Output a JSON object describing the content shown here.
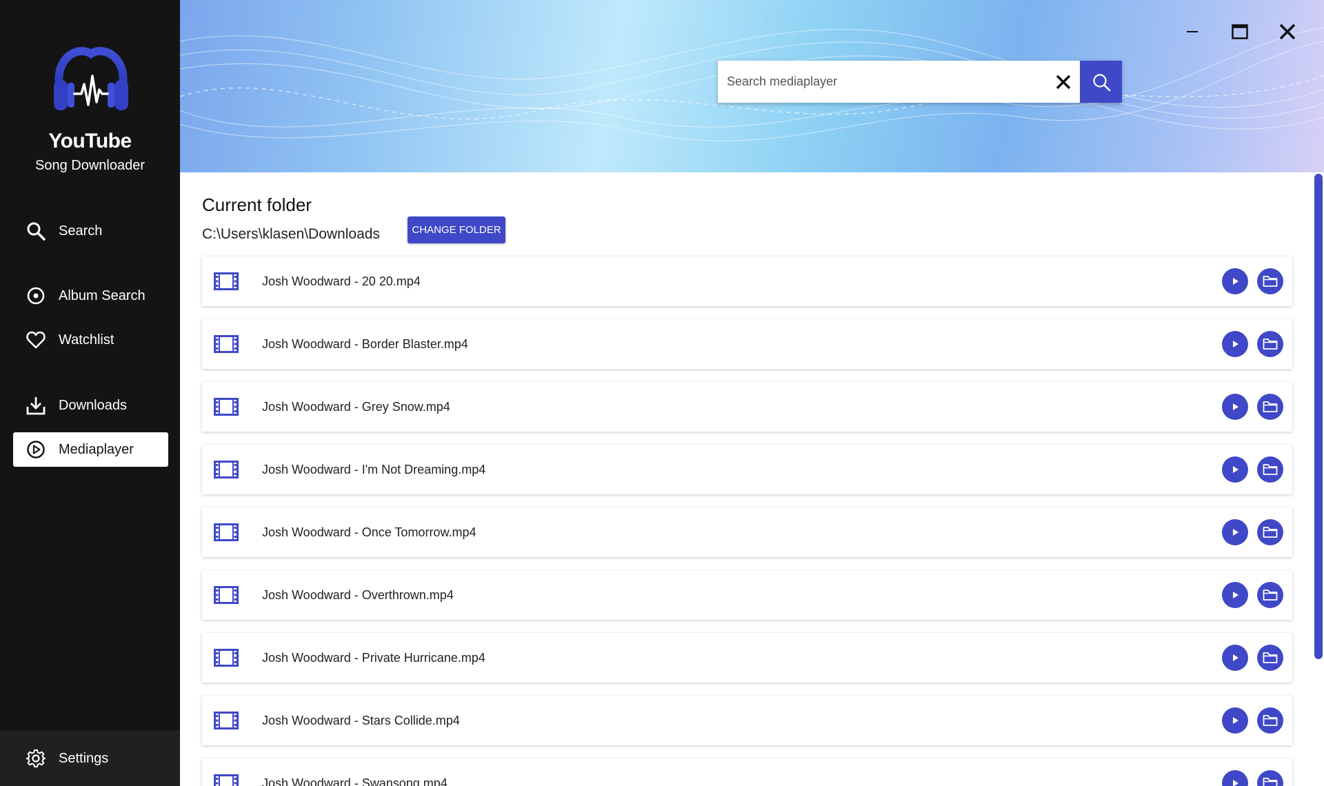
{
  "app": {
    "title": "YouTube",
    "subtitle": "Song Downloader"
  },
  "sidebar": {
    "items": [
      {
        "label": "Search",
        "icon": "search-icon"
      },
      {
        "label": "Album Search",
        "icon": "disc-icon"
      },
      {
        "label": "Watchlist",
        "icon": "heart-icon"
      },
      {
        "label": "Downloads",
        "icon": "download-icon"
      },
      {
        "label": "Mediaplayer",
        "icon": "play-circle-icon",
        "active": true
      }
    ],
    "settings_label": "Settings"
  },
  "search": {
    "placeholder": "Search mediaplayer",
    "value": ""
  },
  "folder": {
    "heading": "Current folder",
    "path": "C:\\Users\\klasen\\Downloads",
    "change_label": "CHANGE FOLDER"
  },
  "files": [
    "Josh Woodward - 20 20.mp4",
    "Josh Woodward - Border Blaster.mp4",
    "Josh Woodward - Grey Snow.mp4",
    "Josh Woodward - I'm Not Dreaming.mp4",
    "Josh Woodward - Once Tomorrow.mp4",
    "Josh Woodward - Overthrown.mp4",
    "Josh Woodward - Private Hurricane.mp4",
    "Josh Woodward - Stars Collide.mp4",
    "Josh Woodward - Swansong.mp4"
  ],
  "colors": {
    "accent": "#3f48c7",
    "sidebar_bg": "#141414",
    "settings_bg": "#202020"
  }
}
